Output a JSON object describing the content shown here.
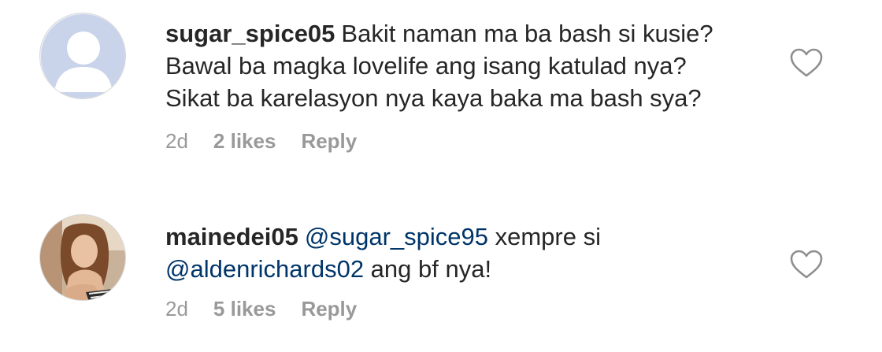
{
  "comments": [
    {
      "username": "sugar_spice05",
      "text": "Bakit naman ma ba bash si kusie?\nBawal ba magka lovelife ang isang katulad nya?\nSikat ba karelasyon nya kaya baka ma bash sya?",
      "time": "2d",
      "likes": "2 likes",
      "reply": "Reply",
      "avatar_icon": "default-avatar-icon"
    },
    {
      "username": "mainedei05",
      "mention1": "@sugar_spice95",
      "text_mid": " xempre si",
      "mention2": "@aldenrichards02",
      "text_end": " ang bf nya!",
      "time": "2d",
      "likes": "5 likes",
      "reply": "Reply",
      "avatar_icon": "profile-photo"
    }
  ],
  "colors": {
    "text": "#262626",
    "meta": "#999999",
    "mention": "#003569",
    "default_avatar_bg": "#c7d2ea"
  }
}
